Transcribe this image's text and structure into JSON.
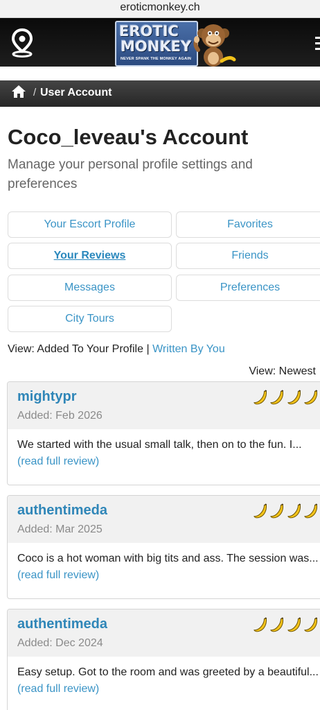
{
  "browser": {
    "url": "eroticmonkey.ch"
  },
  "logo": {
    "line1": "EROTIC",
    "line2": "MONKEY",
    "tagline": "NEVER SPANK THE MONKEY AGAIN"
  },
  "breadcrumb": {
    "separator": "/",
    "current": "User Account"
  },
  "page": {
    "title": "Coco_leveau's Account",
    "subtitle": "Manage your personal profile settings and preferences"
  },
  "nav": {
    "escort_profile": "Your Escort Profile",
    "favorites": "Favorites",
    "reviews": "Your Reviews",
    "friends": "Friends",
    "messages": "Messages",
    "preferences": "Preferences",
    "city_tours": "City Tours",
    "active": "reviews"
  },
  "view": {
    "label": "View: Added To Your Profile",
    "separator": "|",
    "written_by_you": "Written By You",
    "sort": "View: Newest"
  },
  "reviews": [
    {
      "reviewer": "mightypr",
      "added": "Added: Feb 2026",
      "rating": 4,
      "excerpt": "We started with the usual small talk, then on to the fun. I...",
      "read_more": "(read full review)"
    },
    {
      "reviewer": "authentimeda",
      "added": "Added: Mar 2025",
      "rating": 4,
      "excerpt": "Coco is a hot woman with big tits and ass. The session was...",
      "read_more": "(read full review)"
    },
    {
      "reviewer": "authentimeda",
      "added": "Added: Dec 2024",
      "rating": 4,
      "excerpt": "Easy setup. Got to the room and was greeted by a beautiful...",
      "read_more": "(read full review)"
    }
  ],
  "colors": {
    "link": "#3a94c6",
    "reviewer": "#2f86b8",
    "banana": "#f2c21a",
    "header_bg": "#111111"
  },
  "icons": {
    "location": "location-pin-icon",
    "home": "home-icon",
    "menu": "menu-icon",
    "rating": "banana-icon"
  }
}
